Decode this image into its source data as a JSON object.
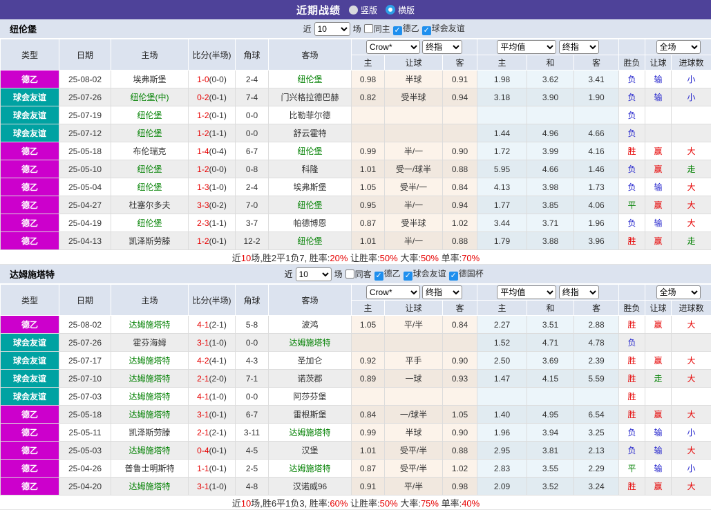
{
  "title_bar": {
    "title": "近期战绩",
    "radio_vertical": "竖版",
    "radio_horizontal": "横版",
    "selected": "横版"
  },
  "colors": {
    "title_bar_bg": "#4e4299",
    "league_badge": "#cc00cc",
    "friendly_badge": "#00a2a2",
    "team_green": "#008000",
    "score_red": "#e60000",
    "checkbox_on": "#1f8fee"
  },
  "sections": [
    {
      "team": "纽伦堡",
      "filter": {
        "near_label": "近",
        "count": "10",
        "games_label": "场",
        "checkboxes": [
          {
            "label": "同主",
            "checked": false
          },
          {
            "label": "德乙",
            "checked": true
          },
          {
            "label": "球会友谊",
            "checked": true
          }
        ]
      },
      "header": {
        "cols": [
          "类型",
          "日期",
          "主场",
          "比分(半场)",
          "角球",
          "客场"
        ],
        "crow_select": "Crow*",
        "crow_final_select": "终指",
        "crow_cols": [
          "主",
          "让球",
          "客"
        ],
        "avg_select": "平均值",
        "avg_final_select": "终指",
        "avg_cols": [
          "主",
          "和",
          "客"
        ],
        "result_col": "胜负",
        "full_select": "全场",
        "full_cols": [
          "让球",
          "进球数"
        ]
      },
      "rows": [
        {
          "lg": "德乙",
          "lgStyle": "league",
          "date": "25-08-02",
          "home": "埃弗斯堡",
          "homeHl": false,
          "score": "1-0",
          "half": "(0-0)",
          "cor": "2-4",
          "away": "纽伦堡",
          "awayHl": true,
          "crow": [
            "0.98",
            "半球",
            "0.91"
          ],
          "avg": [
            "1.98",
            "3.62",
            "3.41"
          ],
          "res": [
            [
              "负",
              "b"
            ],
            [
              "输",
              "b"
            ],
            [
              "小",
              "b"
            ]
          ]
        },
        {
          "lg": "球会友谊",
          "lgStyle": "friendly",
          "date": "25-07-26",
          "home": "纽伦堡(中)",
          "homeHl": true,
          "score": "0-2",
          "half": "(0-1)",
          "cor": "7-4",
          "away": "门兴格拉德巴赫",
          "awayHl": false,
          "crow": [
            "0.82",
            "受半球",
            "0.94"
          ],
          "avg": [
            "3.18",
            "3.90",
            "1.90"
          ],
          "res": [
            [
              "负",
              "b"
            ],
            [
              "输",
              "b"
            ],
            [
              "小",
              "b"
            ]
          ]
        },
        {
          "lg": "球会友谊",
          "lgStyle": "friendly",
          "date": "25-07-19",
          "home": "纽伦堡",
          "homeHl": true,
          "score": "1-2",
          "half": "(0-1)",
          "cor": "0-0",
          "away": "比勒菲尔德",
          "awayHl": false,
          "crow": [
            "",
            "",
            ""
          ],
          "avg": [
            "",
            "",
            ""
          ],
          "res": [
            [
              "负",
              "b"
            ],
            [
              "",
              ""
            ],
            [
              "",
              ""
            ]
          ]
        },
        {
          "lg": "球会友谊",
          "lgStyle": "friendly",
          "date": "25-07-12",
          "home": "纽伦堡",
          "homeHl": true,
          "score": "1-2",
          "half": "(1-1)",
          "cor": "0-0",
          "away": "舒云霍特",
          "awayHl": false,
          "crow": [
            "",
            "",
            ""
          ],
          "avg": [
            "1.44",
            "4.96",
            "4.66"
          ],
          "res": [
            [
              "负",
              "b"
            ],
            [
              "",
              ""
            ],
            [
              "",
              ""
            ]
          ]
        },
        {
          "lg": "德乙",
          "lgStyle": "league",
          "date": "25-05-18",
          "home": "布伦瑞克",
          "homeHl": false,
          "score": "1-4",
          "half": "(0-4)",
          "cor": "6-7",
          "away": "纽伦堡",
          "awayHl": true,
          "crow": [
            "0.99",
            "半/一",
            "0.90"
          ],
          "avg": [
            "1.72",
            "3.99",
            "4.16"
          ],
          "res": [
            [
              "胜",
              "r"
            ],
            [
              "赢",
              "r"
            ],
            [
              "大",
              "r"
            ]
          ]
        },
        {
          "lg": "德乙",
          "lgStyle": "league",
          "date": "25-05-10",
          "home": "纽伦堡",
          "homeHl": true,
          "score": "1-2",
          "half": "(0-0)",
          "cor": "0-8",
          "away": "科隆",
          "awayHl": false,
          "crow": [
            "1.01",
            "受一/球半",
            "0.88"
          ],
          "avg": [
            "5.95",
            "4.66",
            "1.46"
          ],
          "res": [
            [
              "负",
              "b"
            ],
            [
              "赢",
              "r"
            ],
            [
              "走",
              "g"
            ]
          ]
        },
        {
          "lg": "德乙",
          "lgStyle": "league",
          "date": "25-05-04",
          "home": "纽伦堡",
          "homeHl": true,
          "score": "1-3",
          "half": "(1-0)",
          "cor": "2-4",
          "away": "埃弗斯堡",
          "awayHl": false,
          "crow": [
            "1.05",
            "受半/一",
            "0.84"
          ],
          "avg": [
            "4.13",
            "3.98",
            "1.73"
          ],
          "res": [
            [
              "负",
              "b"
            ],
            [
              "输",
              "b"
            ],
            [
              "大",
              "r"
            ]
          ]
        },
        {
          "lg": "德乙",
          "lgStyle": "league",
          "date": "25-04-27",
          "home": "杜塞尔多夫",
          "homeHl": false,
          "score": "3-3",
          "half": "(0-2)",
          "cor": "7-0",
          "away": "纽伦堡",
          "awayHl": true,
          "crow": [
            "0.95",
            "半/一",
            "0.94"
          ],
          "avg": [
            "1.77",
            "3.85",
            "4.06"
          ],
          "res": [
            [
              "平",
              "g"
            ],
            [
              "赢",
              "r"
            ],
            [
              "大",
              "r"
            ]
          ]
        },
        {
          "lg": "德乙",
          "lgStyle": "league",
          "date": "25-04-19",
          "home": "纽伦堡",
          "homeHl": true,
          "score": "2-3",
          "half": "(1-1)",
          "cor": "3-7",
          "away": "帕德博恩",
          "awayHl": false,
          "crow": [
            "0.87",
            "受半球",
            "1.02"
          ],
          "avg": [
            "3.44",
            "3.71",
            "1.96"
          ],
          "res": [
            [
              "负",
              "b"
            ],
            [
              "输",
              "b"
            ],
            [
              "大",
              "r"
            ]
          ]
        },
        {
          "lg": "德乙",
          "lgStyle": "league",
          "date": "25-04-13",
          "home": "凯泽斯劳滕",
          "homeHl": false,
          "score": "1-2",
          "half": "(0-1)",
          "cor": "12-2",
          "away": "纽伦堡",
          "awayHl": true,
          "crow": [
            "1.01",
            "半/一",
            "0.88"
          ],
          "avg": [
            "1.79",
            "3.88",
            "3.96"
          ],
          "res": [
            [
              "胜",
              "r"
            ],
            [
              "赢",
              "r"
            ],
            [
              "走",
              "g"
            ]
          ]
        }
      ],
      "summary_parts": [
        {
          "text": "近",
          "red": false
        },
        {
          "text": "10",
          "red": true
        },
        {
          "text": "场,胜2平1负7, 胜率:",
          "red": false
        },
        {
          "text": "20%",
          "red": true
        },
        {
          "text": " 让胜率:",
          "red": false
        },
        {
          "text": "50%",
          "red": true
        },
        {
          "text": " 大率:",
          "red": false
        },
        {
          "text": "50%",
          "red": true
        },
        {
          "text": " 单率:",
          "red": false
        },
        {
          "text": "70%",
          "red": true
        }
      ]
    },
    {
      "team": "达姆施塔特",
      "filter": {
        "near_label": "近",
        "count": "10",
        "games_label": "场",
        "checkboxes": [
          {
            "label": "同客",
            "checked": false
          },
          {
            "label": "德乙",
            "checked": true
          },
          {
            "label": "球会友谊",
            "checked": true
          },
          {
            "label": "德国杯",
            "checked": true
          }
        ]
      },
      "header": {
        "cols": [
          "类型",
          "日期",
          "主场",
          "比分(半场)",
          "角球",
          "客场"
        ],
        "crow_select": "Crow*",
        "crow_final_select": "终指",
        "crow_cols": [
          "主",
          "让球",
          "客"
        ],
        "avg_select": "平均值",
        "avg_final_select": "终指",
        "avg_cols": [
          "主",
          "和",
          "客"
        ],
        "result_col": "胜负",
        "full_select": "全场",
        "full_cols": [
          "让球",
          "进球数"
        ]
      },
      "rows": [
        {
          "lg": "德乙",
          "lgStyle": "league",
          "date": "25-08-02",
          "home": "达姆施塔特",
          "homeHl": true,
          "score": "4-1",
          "half": "(2-1)",
          "cor": "5-8",
          "away": "波鸿",
          "awayHl": false,
          "crow": [
            "1.05",
            "平/半",
            "0.84"
          ],
          "avg": [
            "2.27",
            "3.51",
            "2.88"
          ],
          "res": [
            [
              "胜",
              "r"
            ],
            [
              "赢",
              "r"
            ],
            [
              "大",
              "r"
            ]
          ]
        },
        {
          "lg": "球会友谊",
          "lgStyle": "friendly",
          "date": "25-07-26",
          "home": "霍芬海姆",
          "homeHl": false,
          "score": "3-1",
          "half": "(1-0)",
          "cor": "0-0",
          "away": "达姆施塔特",
          "awayHl": true,
          "crow": [
            "",
            "",
            ""
          ],
          "avg": [
            "1.52",
            "4.71",
            "4.78"
          ],
          "res": [
            [
              "负",
              "b"
            ],
            [
              "",
              ""
            ],
            [
              "",
              ""
            ]
          ]
        },
        {
          "lg": "球会友谊",
          "lgStyle": "friendly",
          "date": "25-07-17",
          "home": "达姆施塔特",
          "homeHl": true,
          "score": "4-2",
          "half": "(4-1)",
          "cor": "4-3",
          "away": "圣加仑",
          "awayHl": false,
          "crow": [
            "0.92",
            "平手",
            "0.90"
          ],
          "avg": [
            "2.50",
            "3.69",
            "2.39"
          ],
          "res": [
            [
              "胜",
              "r"
            ],
            [
              "赢",
              "r"
            ],
            [
              "大",
              "r"
            ]
          ]
        },
        {
          "lg": "球会友谊",
          "lgStyle": "friendly",
          "date": "25-07-10",
          "home": "达姆施塔特",
          "homeHl": true,
          "score": "2-1",
          "half": "(2-0)",
          "cor": "7-1",
          "away": "诺茨郡",
          "awayHl": false,
          "crow": [
            "0.89",
            "一球",
            "0.93"
          ],
          "avg": [
            "1.47",
            "4.15",
            "5.59"
          ],
          "res": [
            [
              "胜",
              "r"
            ],
            [
              "走",
              "g"
            ],
            [
              "大",
              "r"
            ]
          ]
        },
        {
          "lg": "球会友谊",
          "lgStyle": "friendly",
          "date": "25-07-03",
          "home": "达姆施塔特",
          "homeHl": true,
          "score": "4-1",
          "half": "(1-0)",
          "cor": "0-0",
          "away": "阿莎芬堡",
          "awayHl": false,
          "crow": [
            "",
            "",
            ""
          ],
          "avg": [
            "",
            "",
            ""
          ],
          "res": [
            [
              "胜",
              "r"
            ],
            [
              "",
              ""
            ],
            [
              "",
              ""
            ]
          ]
        },
        {
          "lg": "德乙",
          "lgStyle": "league",
          "date": "25-05-18",
          "home": "达姆施塔特",
          "homeHl": true,
          "score": "3-1",
          "half": "(0-1)",
          "cor": "6-7",
          "away": "雷根斯堡",
          "awayHl": false,
          "crow": [
            "0.84",
            "一/球半",
            "1.05"
          ],
          "avg": [
            "1.40",
            "4.95",
            "6.54"
          ],
          "res": [
            [
              "胜",
              "r"
            ],
            [
              "赢",
              "r"
            ],
            [
              "大",
              "r"
            ]
          ]
        },
        {
          "lg": "德乙",
          "lgStyle": "league",
          "date": "25-05-11",
          "home": "凯泽斯劳滕",
          "homeHl": false,
          "score": "2-1",
          "half": "(2-1)",
          "cor": "3-11",
          "away": "达姆施塔特",
          "awayHl": true,
          "crow": [
            "0.99",
            "半球",
            "0.90"
          ],
          "avg": [
            "1.96",
            "3.94",
            "3.25"
          ],
          "res": [
            [
              "负",
              "b"
            ],
            [
              "输",
              "b"
            ],
            [
              "小",
              "b"
            ]
          ]
        },
        {
          "lg": "德乙",
          "lgStyle": "league",
          "date": "25-05-03",
          "home": "达姆施塔特",
          "homeHl": true,
          "score": "0-4",
          "half": "(0-1)",
          "cor": "4-5",
          "away": "汉堡",
          "awayHl": false,
          "crow": [
            "1.01",
            "受平/半",
            "0.88"
          ],
          "avg": [
            "2.95",
            "3.81",
            "2.13"
          ],
          "res": [
            [
              "负",
              "b"
            ],
            [
              "输",
              "b"
            ],
            [
              "大",
              "r"
            ]
          ]
        },
        {
          "lg": "德乙",
          "lgStyle": "league",
          "date": "25-04-26",
          "home": "普鲁士明斯特",
          "homeHl": false,
          "score": "1-1",
          "half": "(0-1)",
          "cor": "2-5",
          "away": "达姆施塔特",
          "awayHl": true,
          "crow": [
            "0.87",
            "受平/半",
            "1.02"
          ],
          "avg": [
            "2.83",
            "3.55",
            "2.29"
          ],
          "res": [
            [
              "平",
              "g"
            ],
            [
              "输",
              "b"
            ],
            [
              "小",
              "b"
            ]
          ]
        },
        {
          "lg": "德乙",
          "lgStyle": "league",
          "date": "25-04-20",
          "home": "达姆施塔特",
          "homeHl": true,
          "score": "3-1",
          "half": "(1-0)",
          "cor": "4-8",
          "away": "汉诺威96",
          "awayHl": false,
          "crow": [
            "0.91",
            "平/半",
            "0.98"
          ],
          "avg": [
            "2.09",
            "3.52",
            "3.24"
          ],
          "res": [
            [
              "胜",
              "r"
            ],
            [
              "赢",
              "r"
            ],
            [
              "大",
              "r"
            ]
          ]
        }
      ],
      "summary_parts": [
        {
          "text": "近",
          "red": false
        },
        {
          "text": "10",
          "red": true
        },
        {
          "text": "场,胜6平1负3, 胜率:",
          "red": false
        },
        {
          "text": "60%",
          "red": true
        },
        {
          "text": " 让胜率:",
          "red": false
        },
        {
          "text": "50%",
          "red": true
        },
        {
          "text": " 大率:",
          "red": false
        },
        {
          "text": "75%",
          "red": true
        },
        {
          "text": " 单率:",
          "red": false
        },
        {
          "text": "40%",
          "red": true
        }
      ]
    }
  ]
}
